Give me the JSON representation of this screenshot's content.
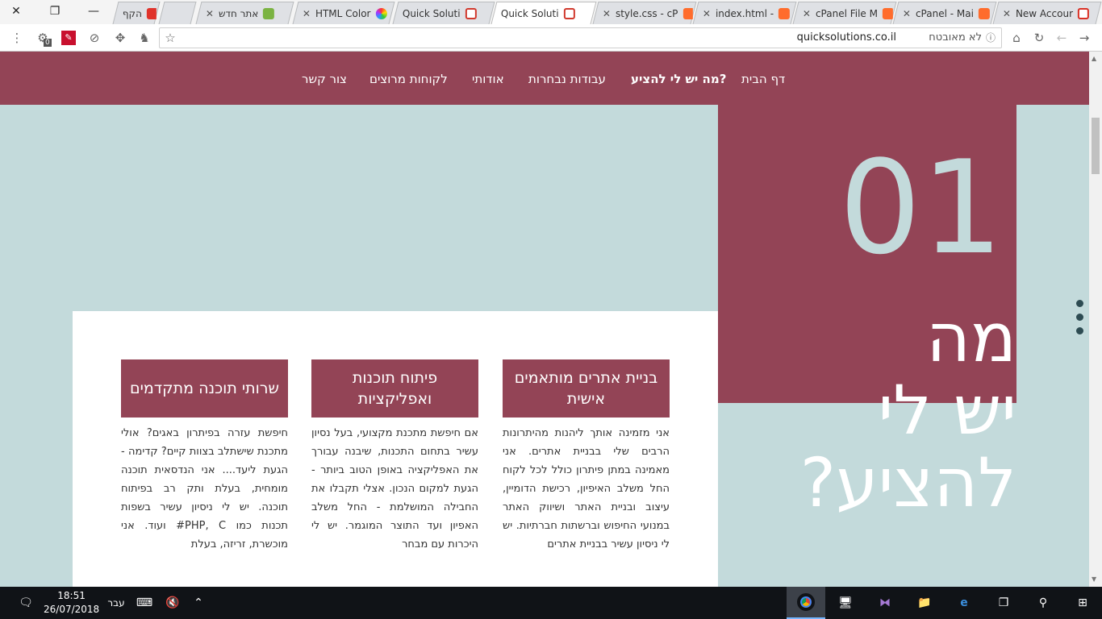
{
  "browser": {
    "tabs": [
      {
        "label": "הקף",
        "favicon": "red-logo"
      },
      {
        "label": "אתר חדש",
        "favicon": "green-site"
      },
      {
        "label": "HTML Color",
        "favicon": "color-wheel"
      },
      {
        "label": "Quick Soluti",
        "favicon": "qs-logo"
      },
      {
        "label": "Quick Soluti",
        "favicon": "qs-logo",
        "active": true
      },
      {
        "label": "style.css - cP",
        "favicon": "cpanel"
      },
      {
        "label": "index.html -",
        "favicon": "cpanel"
      },
      {
        "label": "cPanel File M",
        "favicon": "cpanel"
      },
      {
        "label": "cPanel - Mai",
        "favicon": "cpanel"
      },
      {
        "label": "New Accour",
        "favicon": "gmail"
      }
    ],
    "url": "quicksolutions.co.il",
    "not_secure": "לא מאובטח",
    "extension_badge": "0"
  },
  "nav": {
    "items": [
      {
        "label": "דף הבית"
      },
      {
        "label": "מה יש לי להציע?",
        "active": true
      },
      {
        "label": "עבודות נבחרות"
      },
      {
        "label": "אודותי"
      },
      {
        "label": "לקוחות מרוצים"
      },
      {
        "label": "צור קשר"
      }
    ]
  },
  "hero": {
    "number": "01",
    "title_lines": [
      "מה",
      "יש לי",
      "להציע?"
    ]
  },
  "services": [
    {
      "title": "בניית אתרים מותאמים אישית",
      "body": "אני מזמינה אותך ליהנות מהיתרונות הרבים שלי בבניית אתרים. אני מאמינה במתן פיתרון כולל לכל לקוח החל משלב האיפיון, רכישת הדומיין, עיצוב ובניית האתר ושיווק האתר במנועי החיפוש וברשתות חברתיות. יש לי ניסיון עשיר בבניית אתרים"
    },
    {
      "title": "פיתוח תוכנות ואפליקציות",
      "body": "אם חיפשת מתכנת מקצועי, בעל נסיון עשיר בתחום התכנות, שיבנה עבורך את האפליקציה באופן הטוב ביותר - הגעת למקום הנכון. אצלי תקבלו את החבילה המושלמת - החל משלב האפיון ועד התוצר המוגמר. יש לי היכרות עם מבחר"
    },
    {
      "title": "שרותי תוכנה מתקדמים",
      "body": "חיפשת עזרה בפיתרון באגים? אולי מתכנת שישתלב בצוות קיים? קדימה - הגעת ליעד.... אני הנדסאית תוכנה מומחית, בעלת ותק רב בפיתוח תוכנה. יש לי ניסיון עשיר בשפות תכנות כמו PHP, C# ועוד. אני מוכשרת, זריזה, בעלת"
    }
  ],
  "taskbar": {
    "time": "18:51",
    "date": "26/07/2018",
    "language": "עבר"
  },
  "colors": {
    "maroon": "#934456",
    "light_teal": "#c3dadb"
  }
}
